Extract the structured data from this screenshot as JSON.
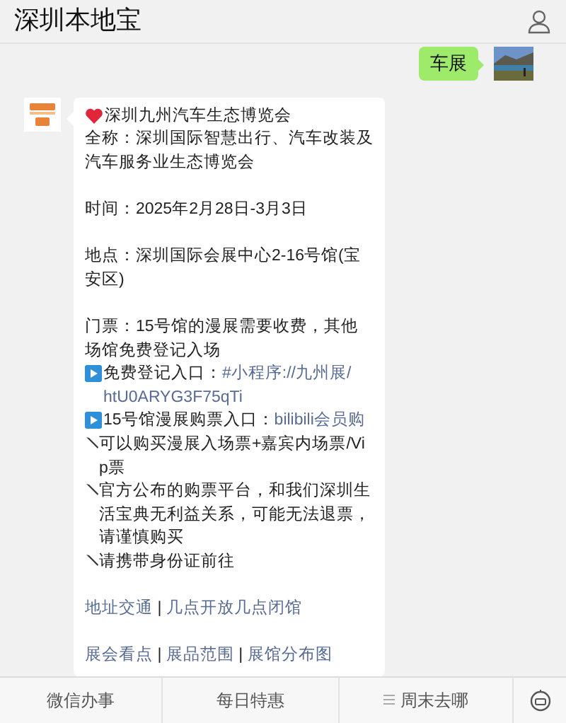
{
  "header": {
    "title": "深圳本地宝"
  },
  "sent_message": {
    "text": "车展"
  },
  "received_message": {
    "paragraphs": [
      {
        "kind": "heart",
        "parts": [
          {
            "kind": "plain",
            "text": "深圳九州汽车生态博览会"
          }
        ]
      },
      {
        "kind": "plain",
        "parts": [
          {
            "kind": "plain",
            "text": "全称：深圳国际智慧出行、汽车改装及汽车服务业生态博览会"
          }
        ]
      },
      {
        "kind": "blank"
      },
      {
        "kind": "plain",
        "parts": [
          {
            "kind": "plain",
            "text": "时间：2025年2月28日-3月3日"
          }
        ]
      },
      {
        "kind": "blank"
      },
      {
        "kind": "plain",
        "parts": [
          {
            "kind": "plain",
            "text": "地点：深圳国际会展中心2-16号馆(宝安区)"
          }
        ]
      },
      {
        "kind": "blank"
      },
      {
        "kind": "plain",
        "parts": [
          {
            "kind": "plain",
            "text": "门票：15号馆的漫展需要收费，其他场馆免费登记入场"
          }
        ]
      },
      {
        "kind": "play",
        "parts": [
          {
            "kind": "plain",
            "text": "免费登记入口："
          },
          {
            "kind": "link",
            "text": "#小程序://九州展/"
          },
          {
            "kind": "link",
            "text": "htU0ARYG3F75qTi"
          }
        ]
      },
      {
        "kind": "play",
        "parts": [
          {
            "kind": "plain",
            "text": "15号馆漫展购票入口："
          },
          {
            "kind": "link",
            "text": "bilibili会员购"
          }
        ]
      },
      {
        "kind": "pencil",
        "parts": [
          {
            "kind": "plain",
            "text": "可以购买漫展入场票+嘉宾内场票/Vip票"
          }
        ]
      },
      {
        "kind": "pencil",
        "parts": [
          {
            "kind": "plain",
            "text": "官方公布的购票平台，和我们深圳生活宝典无利益关系，可能无法退票，请谨慎购买"
          }
        ]
      },
      {
        "kind": "pencil",
        "parts": [
          {
            "kind": "plain",
            "text": "请携带身份证前往"
          }
        ]
      },
      {
        "kind": "blank"
      },
      {
        "kind": "plain",
        "parts": [
          {
            "kind": "link",
            "text": "地址交通"
          },
          {
            "kind": "plain",
            "text": " | "
          },
          {
            "kind": "link",
            "text": "几点开放几点闭馆"
          }
        ]
      },
      {
        "kind": "blank"
      },
      {
        "kind": "plain",
        "parts": [
          {
            "kind": "link",
            "text": "展会看点"
          },
          {
            "kind": "plain",
            "text": " | "
          },
          {
            "kind": "link",
            "text": "展品范围"
          },
          {
            "kind": "plain",
            "text": " | "
          },
          {
            "kind": "link",
            "text": "展馆分布图"
          }
        ]
      }
    ]
  },
  "bottom_menu": [
    {
      "label": "微信办事",
      "kind": "plain"
    },
    {
      "label": "每日特惠",
      "kind": "plain"
    },
    {
      "label": "周末去哪",
      "kind": "submenu"
    }
  ]
}
